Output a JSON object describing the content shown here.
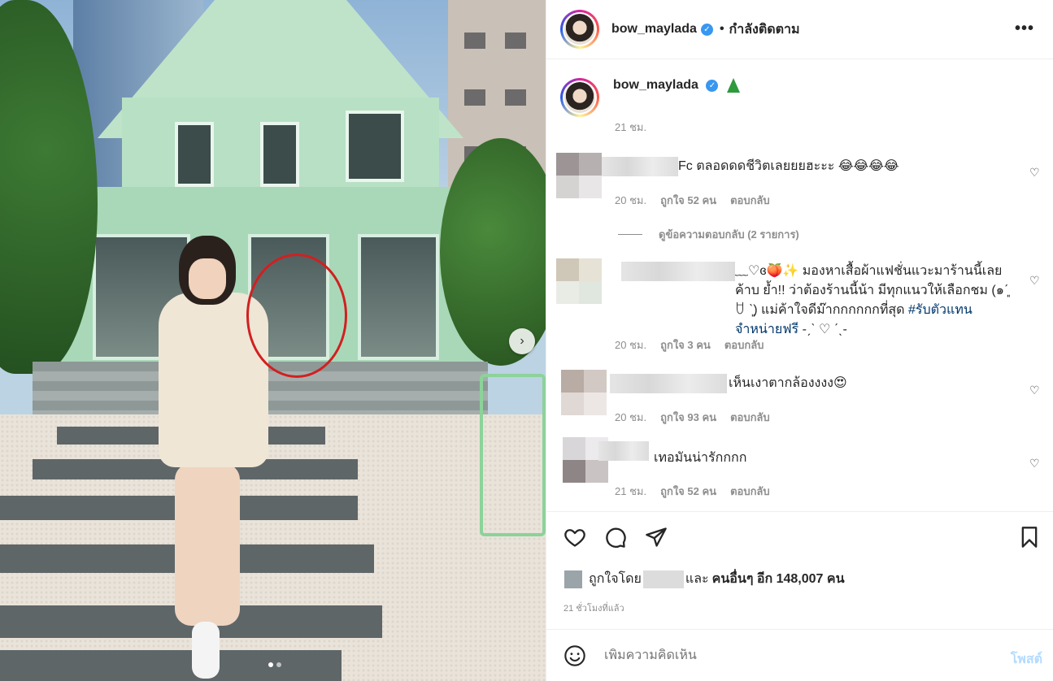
{
  "header": {
    "username": "bow_maylada",
    "separator": "•",
    "follow_status": "กำลังติดตาม",
    "more": "•••"
  },
  "caption": {
    "username": "bow_maylada",
    "time": "21 ชม."
  },
  "comments": [
    {
      "text": "Fc ตลอดดดชีวิตเลยยยฮะะะ 😂😂😂😂",
      "time": "20 ชม.",
      "likes": "ถูกใจ 52 คน",
      "reply": "ตอบกลับ"
    },
    {
      "text_prefix": "﹏♡ɞ🍑✨ มองหาเสื้อผ้าแฟชั่นแวะมาร้านนี้เลยค้าบ ย้ำ!! ว่าต้องร้านนี้น้า มีทุกแนวให้เลือกชม (๑ˊ͈ ꇴ ˋ͈) แม่ค้าใจดีม๊ากกกกกกที่สุด ",
      "hashtag": "#รับตัวแทนจำหน่ายฟรี",
      "text_suffix": " -ˏˋ ♡ ˊˎ-",
      "time": "20 ชม.",
      "likes": "ถูกใจ 3 คน",
      "reply": "ตอบกลับ"
    },
    {
      "text": "เห็นเงาตากล้องงงง😍",
      "time": "20 ชม.",
      "likes": "ถูกใจ 93 คน",
      "reply": "ตอบกลับ"
    },
    {
      "text": "เทอมันน่ารักกกก",
      "time": "21 ชม.",
      "likes": "ถูกใจ 52 คน",
      "reply": "ตอบกลับ"
    }
  ],
  "view_replies": "ดูข้อความตอบกลับ (2 รายการ)",
  "likes_line": {
    "prefix": "ถูกใจโดย",
    "and": "และ",
    "others": "คนอื่นๆ อีก 148,007 คน"
  },
  "time_ago": "21 ชั่วโมงที่แล้ว",
  "add_comment": {
    "placeholder": "เพิ่มความคิดเห็น",
    "post_label": "โพสต์"
  },
  "photo": {
    "next": "›"
  }
}
